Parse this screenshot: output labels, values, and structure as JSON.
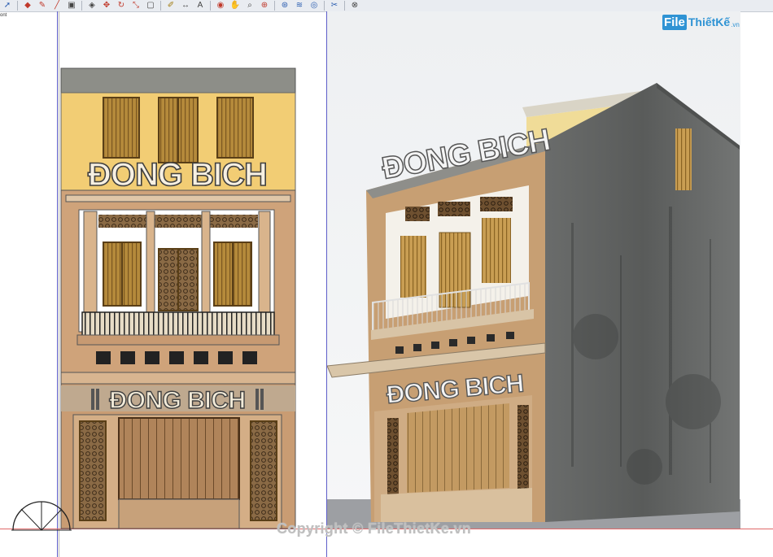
{
  "toolbar": {
    "icons": [
      "select-icon",
      "eraser-icon",
      "pencil-icon",
      "line-icon",
      "shape-icon",
      "push-pull-icon",
      "move-icon",
      "rotate-icon",
      "scale-icon",
      "offset-icon",
      "tape-measure-icon",
      "dimension-icon",
      "text-icon",
      "orbit-icon",
      "pan-icon",
      "zoom-icon",
      "zoom-window-icon",
      "zoom-extents-icon",
      "walk-icon",
      "look-around-icon",
      "section-icon"
    ]
  },
  "side_label": "ont",
  "logo": {
    "box": "File",
    "name": "ThiếtKế",
    "domain": ".vn"
  },
  "elevation": {
    "sign_top": "ĐONG BICH",
    "sign_shop": "ĐONG BICH"
  },
  "render": {
    "sign_top": "ĐONG BICH",
    "sign_shop": "ĐONG BICH"
  },
  "watermark": "Copyright © FileThietKe.vn",
  "colors": {
    "toolbar_bg": "#e9ecf1",
    "axis_blue": "#5e5ec9",
    "axis_red": "#e06868",
    "wall_yellow": "#f2cd74",
    "wall_tan": "#cfa37a",
    "shutter": "#b58a3b",
    "concrete": "#5f6161",
    "logo_blue": "#2f93d4"
  }
}
